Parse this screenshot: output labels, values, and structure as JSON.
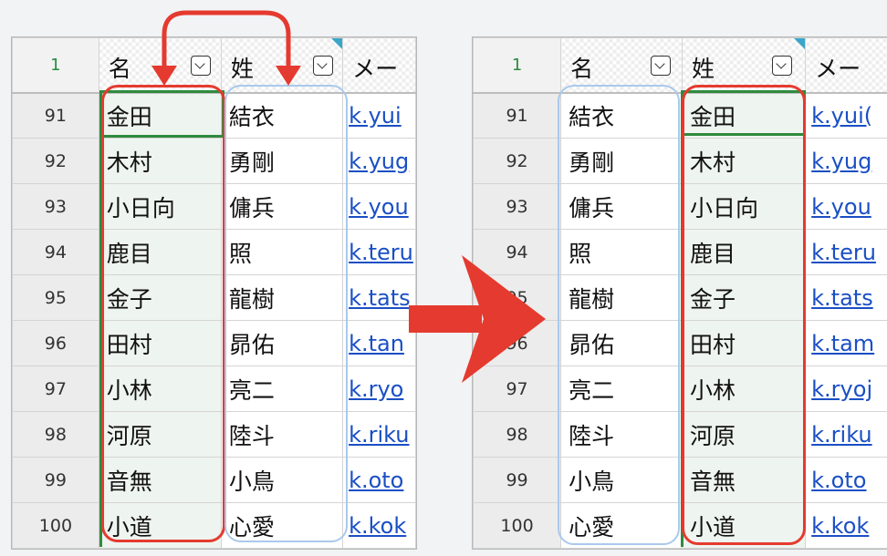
{
  "left_sheet": {
    "top_row_header": "1",
    "columns": [
      {
        "label": "名",
        "has_dropdown": true
      },
      {
        "label": "姓",
        "has_dropdown": true
      },
      {
        "label": "メー"
      }
    ],
    "rows": [
      {
        "num": "91",
        "c1": "金田",
        "c2": "結衣",
        "email": "k.yui"
      },
      {
        "num": "92",
        "c1": "木村",
        "c2": "勇剛",
        "email": "k.yug"
      },
      {
        "num": "93",
        "c1": "小日向",
        "c2": "傭兵",
        "email": "k.you"
      },
      {
        "num": "94",
        "c1": "鹿目",
        "c2": "照",
        "email": "k.teru"
      },
      {
        "num": "95",
        "c1": "金子",
        "c2": "龍樹",
        "email": "k.tats"
      },
      {
        "num": "96",
        "c1": "田村",
        "c2": "昴佑",
        "email": "k.tan"
      },
      {
        "num": "97",
        "c1": "小林",
        "c2": "亮二",
        "email": "k.ryo"
      },
      {
        "num": "98",
        "c1": "河原",
        "c2": "陸斗",
        "email": "k.riku"
      },
      {
        "num": "99",
        "c1": "音無",
        "c2": "小鳥",
        "email": "k.oto"
      },
      {
        "num": "100",
        "c1": "小道",
        "c2": "心愛",
        "email": "k.kok"
      }
    ]
  },
  "right_sheet": {
    "top_row_header": "1",
    "columns": [
      {
        "label": "名",
        "has_dropdown": true
      },
      {
        "label": "姓",
        "has_dropdown": true
      },
      {
        "label": "メー"
      }
    ],
    "rows": [
      {
        "num": "91",
        "c1": "結衣",
        "c2": "金田",
        "email": "k.yui("
      },
      {
        "num": "92",
        "c1": "勇剛",
        "c2": "木村",
        "email": "k.yug"
      },
      {
        "num": "93",
        "c1": "傭兵",
        "c2": "小日向",
        "email": "k.you"
      },
      {
        "num": "94",
        "c1": "照",
        "c2": "鹿目",
        "email": "k.teru"
      },
      {
        "num": "95",
        "c1": "龍樹",
        "c2": "金子",
        "email": "k.tats"
      },
      {
        "num": "96",
        "c1": "昴佑",
        "c2": "田村",
        "email": "k.tam"
      },
      {
        "num": "97",
        "c1": "亮二",
        "c2": "小林",
        "email": "k.ryoj"
      },
      {
        "num": "98",
        "c1": "陸斗",
        "c2": "河原",
        "email": "k.riku"
      },
      {
        "num": "99",
        "c1": "小鳥",
        "c2": "音無",
        "email": "k.oto"
      },
      {
        "num": "100",
        "c1": "心愛",
        "c2": "小道",
        "email": "k.kok"
      }
    ]
  },
  "colors": {
    "highlight_red": "#e53a2f",
    "highlight_blue": "#a9c9ec",
    "selection_green": "#2e8b3e",
    "selection_fill": "#eef4ef",
    "link_blue": "#1a4fc4",
    "arrow_red": "#e53a2f"
  },
  "icons": [
    "dropdown-filter-icon",
    "swap-arrow-icon",
    "right-arrow-icon"
  ]
}
